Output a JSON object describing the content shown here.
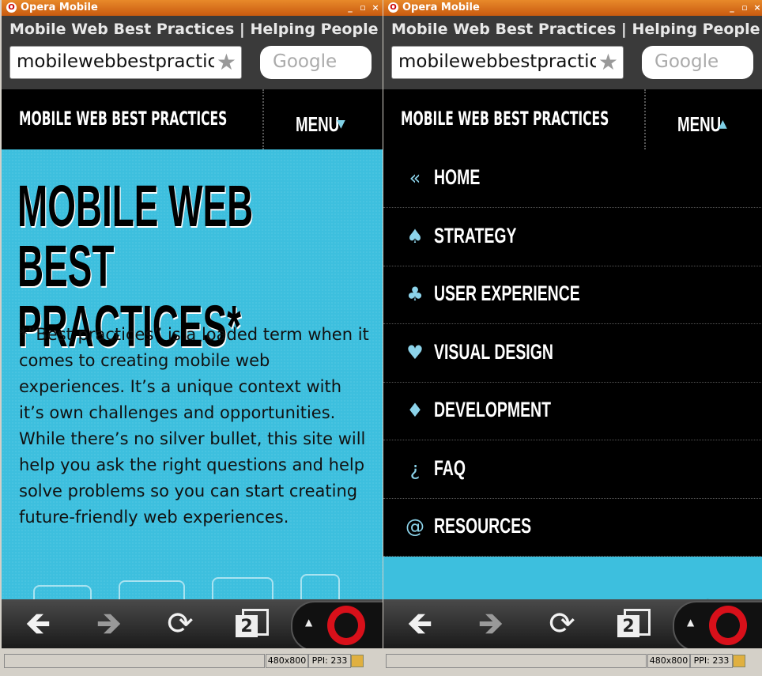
{
  "window": {
    "title": "Opera Mobile",
    "min": "_",
    "max": "▫",
    "close": "×"
  },
  "browser": {
    "page_title": "Mobile Web Best Practices | Helping People M...",
    "url": "mobilewebbestpractices",
    "search_placeholder": "Google",
    "tab_count": "2",
    "status": {
      "resolution": "480x800",
      "ppi": "PPI: 233"
    }
  },
  "site": {
    "logo": "MOBILE WEB BEST PRACTICES",
    "menu_label": "MENU",
    "menu_arrow_down": "▼",
    "menu_arrow_up": "▲",
    "hero_title_line1": "MOBILE WEB BEST",
    "hero_title_line2": "PRACTICES*",
    "hero_text": "*”Best practices” is a loaded term when it comes to creating mobile web experiences. It’s a unique context with it’s own challenges and opportunities. While there’s no silver bullet, this site will help you ask the right questions and help solve problems so you can start creating future-friendly web experiences.",
    "hero_peek": "MOBILE WEB BEST"
  },
  "nav": {
    "items": [
      {
        "icon": "«",
        "label": "HOME"
      },
      {
        "icon": "♠",
        "label": "STRATEGY"
      },
      {
        "icon": "♣",
        "label": "USER EXPERIENCE"
      },
      {
        "icon": "♥",
        "label": "VISUAL DESIGN"
      },
      {
        "icon": "♦",
        "label": "DEVELOPMENT"
      },
      {
        "icon": "¿",
        "label": "FAQ"
      },
      {
        "icon": "@",
        "label": "RESOURCES"
      }
    ]
  },
  "toolbar": {
    "back": "🡸",
    "forward": "🡺",
    "reload": "⟳",
    "up": "▲"
  },
  "colors": {
    "accent": "#3dbfde",
    "icon_blue": "#8cd3ea",
    "opera_red": "#d8101a"
  }
}
